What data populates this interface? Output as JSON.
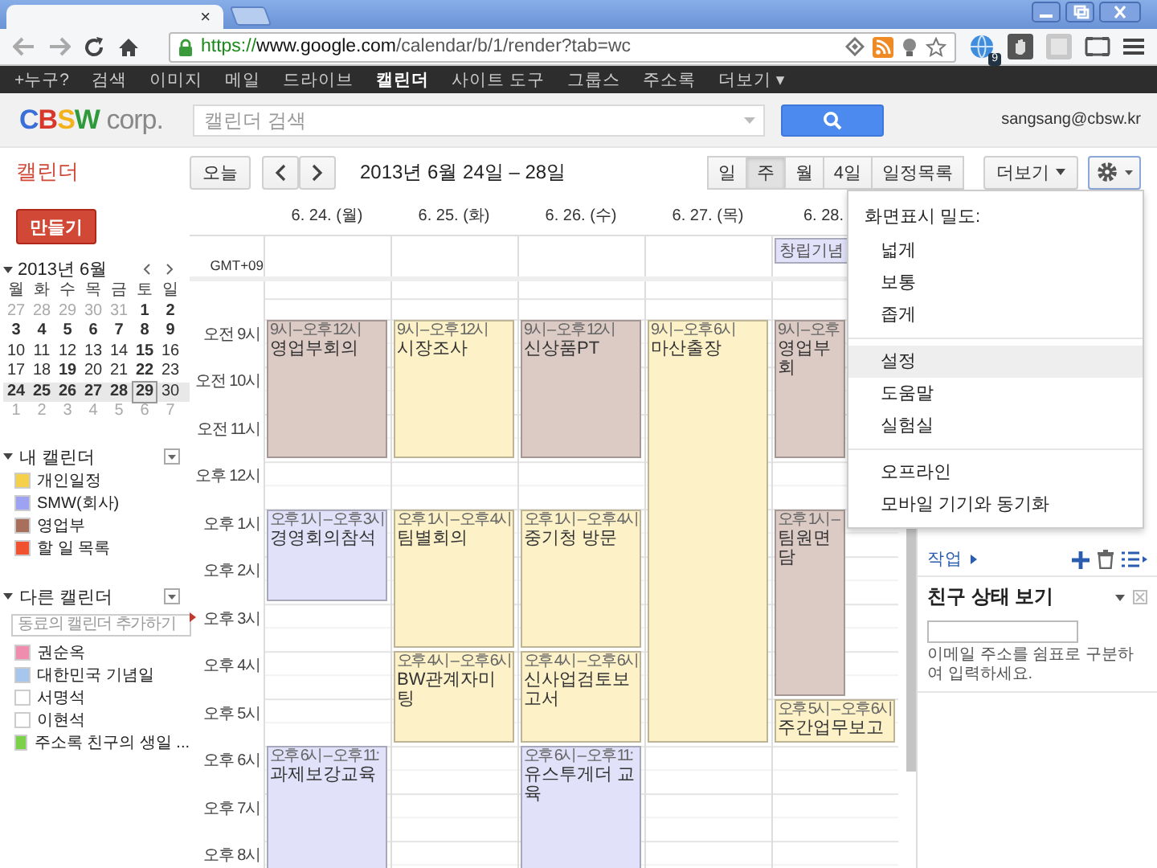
{
  "browser": {
    "tab_close": "×",
    "url_scheme": "https://",
    "url_host": "www.google.com",
    "url_path": "/calendar/b/1/render?tab=wc",
    "extension_badge": "9"
  },
  "google_bar": [
    {
      "label": "+누구?",
      "selected": false
    },
    {
      "label": "검색",
      "selected": false
    },
    {
      "label": "이미지",
      "selected": false
    },
    {
      "label": "메일",
      "selected": false
    },
    {
      "label": "드라이브",
      "selected": false
    },
    {
      "label": "캘린더",
      "selected": true
    },
    {
      "label": "사이트 도구",
      "selected": false
    },
    {
      "label": "그룹스",
      "selected": false
    },
    {
      "label": "주소록",
      "selected": false
    },
    {
      "label": "더보기 ▾",
      "selected": false
    }
  ],
  "header": {
    "logo_letters": [
      {
        "text": "C",
        "color": "#3a6fd8"
      },
      {
        "text": "B",
        "color": "#d8382c"
      },
      {
        "text": "S",
        "color": "#f2b21c"
      },
      {
        "text": "W",
        "color": "#2f9a3c"
      }
    ],
    "logo_suffix": "corp.",
    "search_placeholder": "캘린더 검색",
    "account": "sangsang@cbsw.kr"
  },
  "toolbar": {
    "app_title": "캘린더",
    "today": "오늘",
    "date_range": "2013년 6월 24일 – 28일",
    "views": [
      {
        "label": "일",
        "selected": false
      },
      {
        "label": "주",
        "selected": true
      },
      {
        "label": "월",
        "selected": false
      },
      {
        "label": "4일",
        "selected": false
      },
      {
        "label": "일정목록",
        "selected": false
      }
    ],
    "more": "더보기"
  },
  "sidebar": {
    "create": "만들기",
    "mini_calendar": {
      "title": "2013년 6월",
      "weekdays": [
        "월",
        "화",
        "수",
        "목",
        "금",
        "토",
        "일"
      ],
      "weeks": [
        {
          "selected": false,
          "days": [
            {
              "label": "27",
              "other_month": true,
              "bold": false,
              "today": false
            },
            {
              "label": "28",
              "other_month": true,
              "bold": false,
              "today": false
            },
            {
              "label": "29",
              "other_month": true,
              "bold": false,
              "today": false
            },
            {
              "label": "30",
              "other_month": true,
              "bold": false,
              "today": false
            },
            {
              "label": "31",
              "other_month": true,
              "bold": false,
              "today": false
            },
            {
              "label": "1",
              "other_month": false,
              "bold": true,
              "today": false
            },
            {
              "label": "2",
              "other_month": false,
              "bold": true,
              "today": false
            }
          ]
        },
        {
          "selected": false,
          "days": [
            {
              "label": "3",
              "other_month": false,
              "bold": true,
              "today": false
            },
            {
              "label": "4",
              "other_month": false,
              "bold": true,
              "today": false
            },
            {
              "label": "5",
              "other_month": false,
              "bold": true,
              "today": false
            },
            {
              "label": "6",
              "other_month": false,
              "bold": true,
              "today": false
            },
            {
              "label": "7",
              "other_month": false,
              "bold": true,
              "today": false
            },
            {
              "label": "8",
              "other_month": false,
              "bold": true,
              "today": false
            },
            {
              "label": "9",
              "other_month": false,
              "bold": true,
              "today": false
            }
          ]
        },
        {
          "selected": false,
          "days": [
            {
              "label": "10",
              "other_month": false,
              "bold": false,
              "today": false
            },
            {
              "label": "11",
              "other_month": false,
              "bold": false,
              "today": false
            },
            {
              "label": "12",
              "other_month": false,
              "bold": false,
              "today": false
            },
            {
              "label": "13",
              "other_month": false,
              "bold": false,
              "today": false
            },
            {
              "label": "14",
              "other_month": false,
              "bold": false,
              "today": false
            },
            {
              "label": "15",
              "other_month": false,
              "bold": true,
              "today": false
            },
            {
              "label": "16",
              "other_month": false,
              "bold": false,
              "today": false
            }
          ]
        },
        {
          "selected": false,
          "days": [
            {
              "label": "17",
              "other_month": false,
              "bold": false,
              "today": false
            },
            {
              "label": "18",
              "other_month": false,
              "bold": false,
              "today": false
            },
            {
              "label": "19",
              "other_month": false,
              "bold": true,
              "today": false
            },
            {
              "label": "20",
              "other_month": false,
              "bold": false,
              "today": false
            },
            {
              "label": "21",
              "other_month": false,
              "bold": false,
              "today": false
            },
            {
              "label": "22",
              "other_month": false,
              "bold": true,
              "today": false
            },
            {
              "label": "23",
              "other_month": false,
              "bold": false,
              "today": false
            }
          ]
        },
        {
          "selected": true,
          "days": [
            {
              "label": "24",
              "other_month": false,
              "bold": true,
              "today": false
            },
            {
              "label": "25",
              "other_month": false,
              "bold": true,
              "today": false
            },
            {
              "label": "26",
              "other_month": false,
              "bold": true,
              "today": false
            },
            {
              "label": "27",
              "other_month": false,
              "bold": true,
              "today": false
            },
            {
              "label": "28",
              "other_month": false,
              "bold": true,
              "today": false
            },
            {
              "label": "29",
              "other_month": false,
              "bold": true,
              "today": true
            },
            {
              "label": "30",
              "other_month": false,
              "bold": false,
              "today": false
            }
          ]
        },
        {
          "selected": false,
          "days": [
            {
              "label": "1",
              "other_month": true,
              "bold": false,
              "today": false
            },
            {
              "label": "2",
              "other_month": true,
              "bold": false,
              "today": false
            },
            {
              "label": "3",
              "other_month": true,
              "bold": false,
              "today": false
            },
            {
              "label": "4",
              "other_month": true,
              "bold": false,
              "today": false
            },
            {
              "label": "5",
              "other_month": true,
              "bold": false,
              "today": false
            },
            {
              "label": "6",
              "other_month": true,
              "bold": false,
              "today": false
            },
            {
              "label": "7",
              "other_month": true,
              "bold": false,
              "today": false
            }
          ]
        }
      ]
    },
    "my_calendars": {
      "title": "내 캘린더",
      "items": [
        {
          "name": "개인일정",
          "color": "#f5d04a"
        },
        {
          "name": "SMW(회사)",
          "color": "#9ea2f2"
        },
        {
          "name": "영업부",
          "color": "#a8705c"
        },
        {
          "name": "할 일 목록",
          "color": "#f0512e"
        }
      ]
    },
    "other_calendars": {
      "title": "다른 캘린더",
      "placeholder": "동료의 캘린더 추가하기",
      "items": [
        {
          "name": "권순옥",
          "color": "#f08cae"
        },
        {
          "name": "대한민국 기념일",
          "color": "#a6c6ee"
        },
        {
          "name": "서명석",
          "color": "#ffffff"
        },
        {
          "name": "이현석",
          "color": "#ffffff"
        },
        {
          "name": "주소록 친구의 생일 ...",
          "color": "#7bd148"
        }
      ]
    }
  },
  "calendar": {
    "timezone": "GMT+09",
    "hours": [
      "오전 9시",
      "오전 10시",
      "오전 11시",
      "오후 12시",
      "오후 1시",
      "오후 2시",
      "오후 3시",
      "오후 4시",
      "오후 5시",
      "오후 6시",
      "오후 7시",
      "오후 8시"
    ],
    "days": [
      {
        "label": "6. 24. (월)",
        "slots": [
          {
            "kind": "empty"
          },
          {
            "kind": "start",
            "time": "9시 – 오후 12시",
            "title": "영업부회의",
            "color": "#dccac4"
          },
          {
            "kind": "cont"
          },
          {
            "kind": "cont"
          },
          {
            "kind": "empty"
          },
          {
            "kind": "start",
            "time": "오후 1시 – 오후 3시",
            "title": "경영회의참석",
            "color": "#e1e1fa"
          },
          {
            "kind": "cont"
          },
          {
            "kind": "empty"
          },
          {
            "kind": "empty"
          },
          {
            "kind": "empty"
          },
          {
            "kind": "start",
            "time": "오후 6시 – 오후 11:",
            "title": "과제보강교육",
            "color": "#e1e1fa"
          },
          {
            "kind": "cont"
          },
          {
            "kind": "cont"
          }
        ]
      },
      {
        "label": "6. 25. (화)",
        "slots": [
          {
            "kind": "empty"
          },
          {
            "kind": "start",
            "time": "9시 – 오후 12시",
            "title": "시장조사",
            "color": "#fdf1c8"
          },
          {
            "kind": "cont"
          },
          {
            "kind": "cont"
          },
          {
            "kind": "empty"
          },
          {
            "kind": "start",
            "time": "오후 1시 – 오후 4시",
            "title": "팀별회의",
            "color": "#fdf1c8"
          },
          {
            "kind": "cont"
          },
          {
            "kind": "cont"
          },
          {
            "kind": "start",
            "time": "오후 4시 – 오후 6시",
            "title": "BW관계자미팅",
            "color": "#fdf1c8"
          },
          {
            "kind": "cont"
          },
          {
            "kind": "empty"
          },
          {
            "kind": "empty"
          },
          {
            "kind": "empty"
          }
        ]
      },
      {
        "label": "6. 26. (수)",
        "slots": [
          {
            "kind": "empty"
          },
          {
            "kind": "start",
            "time": "9시 – 오후 12시",
            "title": "신상품PT",
            "color": "#dccac4"
          },
          {
            "kind": "cont"
          },
          {
            "kind": "cont"
          },
          {
            "kind": "empty"
          },
          {
            "kind": "start",
            "time": "오후 1시 – 오후 4시",
            "title": "중기청 방문",
            "color": "#fdf1c8"
          },
          {
            "kind": "cont"
          },
          {
            "kind": "cont"
          },
          {
            "kind": "start",
            "time": "오후 4시 – 오후 6시",
            "title": "신사업검토보고서",
            "color": "#fdf1c8"
          },
          {
            "kind": "cont"
          },
          {
            "kind": "start",
            "time": "오후 6시 – 오후 11:",
            "title": "유스투게더 교육",
            "color": "#e1e1fa"
          },
          {
            "kind": "cont"
          },
          {
            "kind": "cont"
          }
        ]
      },
      {
        "label": "6. 27. (목)",
        "slots": [
          {
            "kind": "empty"
          },
          {
            "kind": "start",
            "time": "9시 – 오후 6시",
            "title": "마산출장",
            "color": "#fdf1c8"
          },
          {
            "kind": "cont"
          },
          {
            "kind": "cont"
          },
          {
            "kind": "cont"
          },
          {
            "kind": "cont"
          },
          {
            "kind": "cont"
          },
          {
            "kind": "cont"
          },
          {
            "kind": "cont"
          },
          {
            "kind": "cont"
          },
          {
            "kind": "empty"
          },
          {
            "kind": "empty"
          },
          {
            "kind": "empty"
          }
        ]
      },
      {
        "label": "6. 28.",
        "all_day": [
          {
            "title": "창립기념",
            "color": "#e1e1fa"
          }
        ],
        "slots": [
          {
            "kind": "empty"
          },
          {
            "kind": "start",
            "time": "9시 – 오후",
            "title": "영업부회",
            "color": "#dccac4"
          },
          {
            "kind": "cont"
          },
          {
            "kind": "cont"
          },
          {
            "kind": "empty"
          },
          {
            "kind": "start",
            "time": "오후 1시 –",
            "title": "팀원면담",
            "color": "#dccac4"
          },
          {
            "kind": "cont"
          },
          {
            "kind": "cont"
          },
          {
            "kind": "cont"
          },
          {
            "kind": "start",
            "time": "오후 5시 – 오후 6시",
            "title": "주간업무보고",
            "color": "#fdf1c8"
          },
          {
            "kind": "empty"
          },
          {
            "kind": "empty"
          },
          {
            "kind": "empty"
          }
        ]
      }
    ]
  },
  "right_panel": {
    "tasks": "작업",
    "friends_title": "친구 상태 보기",
    "friends_hint": "이메일 주소를 쉼표로 구분하여 입력하세요."
  },
  "menu": {
    "heading": "화면표시 밀도:",
    "groups": [
      {
        "items": [
          {
            "label": "넓게",
            "selected": false
          },
          {
            "label": "보통",
            "selected": false
          },
          {
            "label": "좁게",
            "selected": false
          }
        ]
      },
      {
        "items": [
          {
            "label": "설정",
            "selected": true
          },
          {
            "label": "도움말",
            "selected": false
          },
          {
            "label": "실험실",
            "selected": false
          }
        ]
      },
      {
        "items": [
          {
            "label": "오프라인",
            "selected": false
          },
          {
            "label": "모바일 기기와 동기화",
            "selected": false
          }
        ]
      }
    ]
  }
}
